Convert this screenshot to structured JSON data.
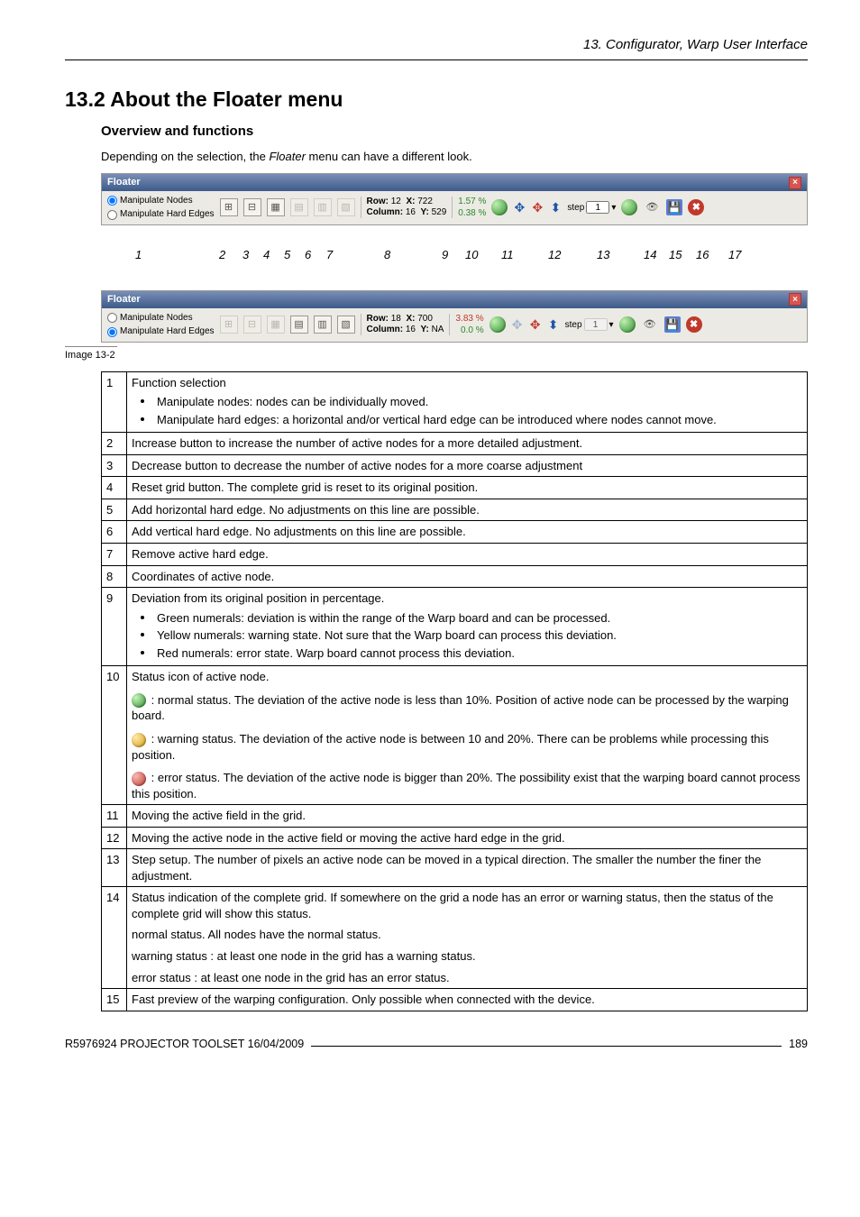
{
  "header": {
    "chapter": "13. Configurator, Warp User Interface"
  },
  "section": {
    "num_title": "13.2  About the Floater menu",
    "sub": "Overview and functions"
  },
  "intro": {
    "pre": "Depending on the selection, the ",
    "em": "Floater",
    "post": " menu can have a different look."
  },
  "floater": {
    "title": "Floater",
    "radio1": "Manipulate Nodes",
    "radio2": "Manipulate Hard Edges",
    "rowA": {
      "row_lbl": "Row:",
      "row_v": "12",
      "col_lbl": "Column:",
      "col_v": "16",
      "x_lbl": "X:",
      "x_v": "722",
      "y_lbl": "Y:",
      "y_v": "529",
      "p1": "1.57 %",
      "p2": "0.38 %"
    },
    "rowB": {
      "row_lbl": "Row:",
      "row_v": "18",
      "col_lbl": "Column:",
      "col_v": "16",
      "x_lbl": "X:",
      "x_v": "700",
      "y_lbl": "Y:",
      "y_v": "NA",
      "p1": "3.83 %",
      "p2": "0.0 %"
    },
    "step_lbl": "step",
    "step_val": "1"
  },
  "indices": [
    "1",
    "2",
    "3",
    "4",
    "5",
    "6",
    "7",
    "8",
    "9",
    "10",
    "11",
    "12",
    "13",
    "14",
    "15",
    "16",
    "17"
  ],
  "caption": "Image 13-2",
  "rows": {
    "1": {
      "head": "Function selection",
      "b1": "Manipulate nodes: nodes can be individually moved.",
      "b2": "Manipulate hard edges: a horizontal and/or vertical hard edge can be introduced where nodes cannot move."
    },
    "2": "Increase button to increase the number of active nodes for a more detailed adjustment.",
    "3": "Decrease button to decrease the number of active nodes for a more coarse adjustment",
    "4": "Reset grid button. The complete grid is reset to its original position.",
    "5": "Add horizontal hard edge. No adjustments on this line are possible.",
    "6": "Add vertical hard edge. No adjustments on this line are possible.",
    "7": "Remove active hard edge.",
    "8": "Coordinates of active node.",
    "9": {
      "head": "Deviation from its original position in percentage.",
      "b1": "Green numerals: deviation is within the range of the Warp board and can be processed.",
      "b2": "Yellow numerals: warning state. Not sure that the Warp board can process this deviation.",
      "b3": "Red numerals: error state. Warp board cannot process this deviation."
    },
    "10": {
      "head": "Status icon of active node.",
      "g": " : normal status. The deviation of the active node is less than 10%. Position of active node can be processed by the warping board.",
      "y": " : warning status. The deviation of the active node is between 10 and 20%. There can be problems while processing this position.",
      "r": " : error status. The deviation of the active node is bigger than 20%. The possibility exist that the warping board cannot process this position."
    },
    "11": "Moving the active field in the grid.",
    "12": "Moving the active node in the active field or moving the active hard edge in the grid.",
    "13": "Step setup. The number of pixels an active node can be moved in a typical direction. The smaller the number the finer the adjustment.",
    "14": {
      "head": "Status indication of the complete grid. If somewhere on the grid a node has an error or warning status, then the status of the complete grid will show this status.",
      "l1": "normal status. All nodes have the normal status.",
      "l2": "warning status : at least one node in the grid has a warning status.",
      "l3": "error status : at least one node in the grid has an error status."
    },
    "15": "Fast preview of the warping configuration. Only possible when connected with the device."
  },
  "footer": {
    "left": "R5976924   PROJECTOR TOOLSET   16/04/2009",
    "right": "189"
  }
}
